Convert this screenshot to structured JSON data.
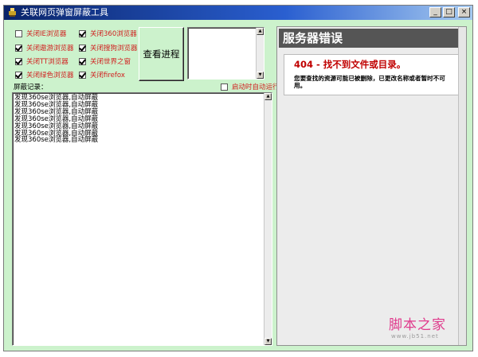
{
  "window": {
    "title": "关联网页弹窗屏蔽工具",
    "min_btn": "_",
    "max_btn": "□",
    "close_btn": "×"
  },
  "options": [
    {
      "label": "关闭IE浏览器",
      "checked": false
    },
    {
      "label": "关闭360浏览器",
      "checked": true
    },
    {
      "label": "关闭遨游浏览器",
      "checked": true
    },
    {
      "label": "关闭搜狗浏览器",
      "checked": true
    },
    {
      "label": "关闭TT浏览器",
      "checked": true
    },
    {
      "label": "关闭世界之窗",
      "checked": true
    },
    {
      "label": "关闭绿色浏览器",
      "checked": true
    },
    {
      "label": "关闭firefox",
      "checked": true
    }
  ],
  "view_process_button": "查看进程",
  "autostart": {
    "label": "启动时自动运行",
    "checked": false
  },
  "log": {
    "label": "屏蔽记录：",
    "lines": [
      "发现360se浏览器,自动屏蔽",
      "发现360se浏览器,自动屏蔽",
      "发现360se浏览器,自动屏蔽",
      "发现360se浏览器,自动屏蔽",
      "发现360se浏览器,自动屏蔽",
      "发现360se浏览器,自动屏蔽",
      "发现360se浏览器,自动屏蔽"
    ]
  },
  "browser": {
    "header": "服务器错误",
    "error_title": "404 - 找不到文件或目录。",
    "error_message": "您要查找的资源可能已被删除，已更改名称或者暂时不可用。"
  },
  "watermark": {
    "main": "脚本之家",
    "sub": "www.jb51.net"
  },
  "icons": {
    "scroll_up": "up-arrow-icon",
    "scroll_down": "down-arrow-icon"
  },
  "colors": {
    "window_bg": "#ccf2cc",
    "checkbox_label": "#d11d1d",
    "error_title": "#c00000",
    "watermark": "#e03a8c"
  }
}
